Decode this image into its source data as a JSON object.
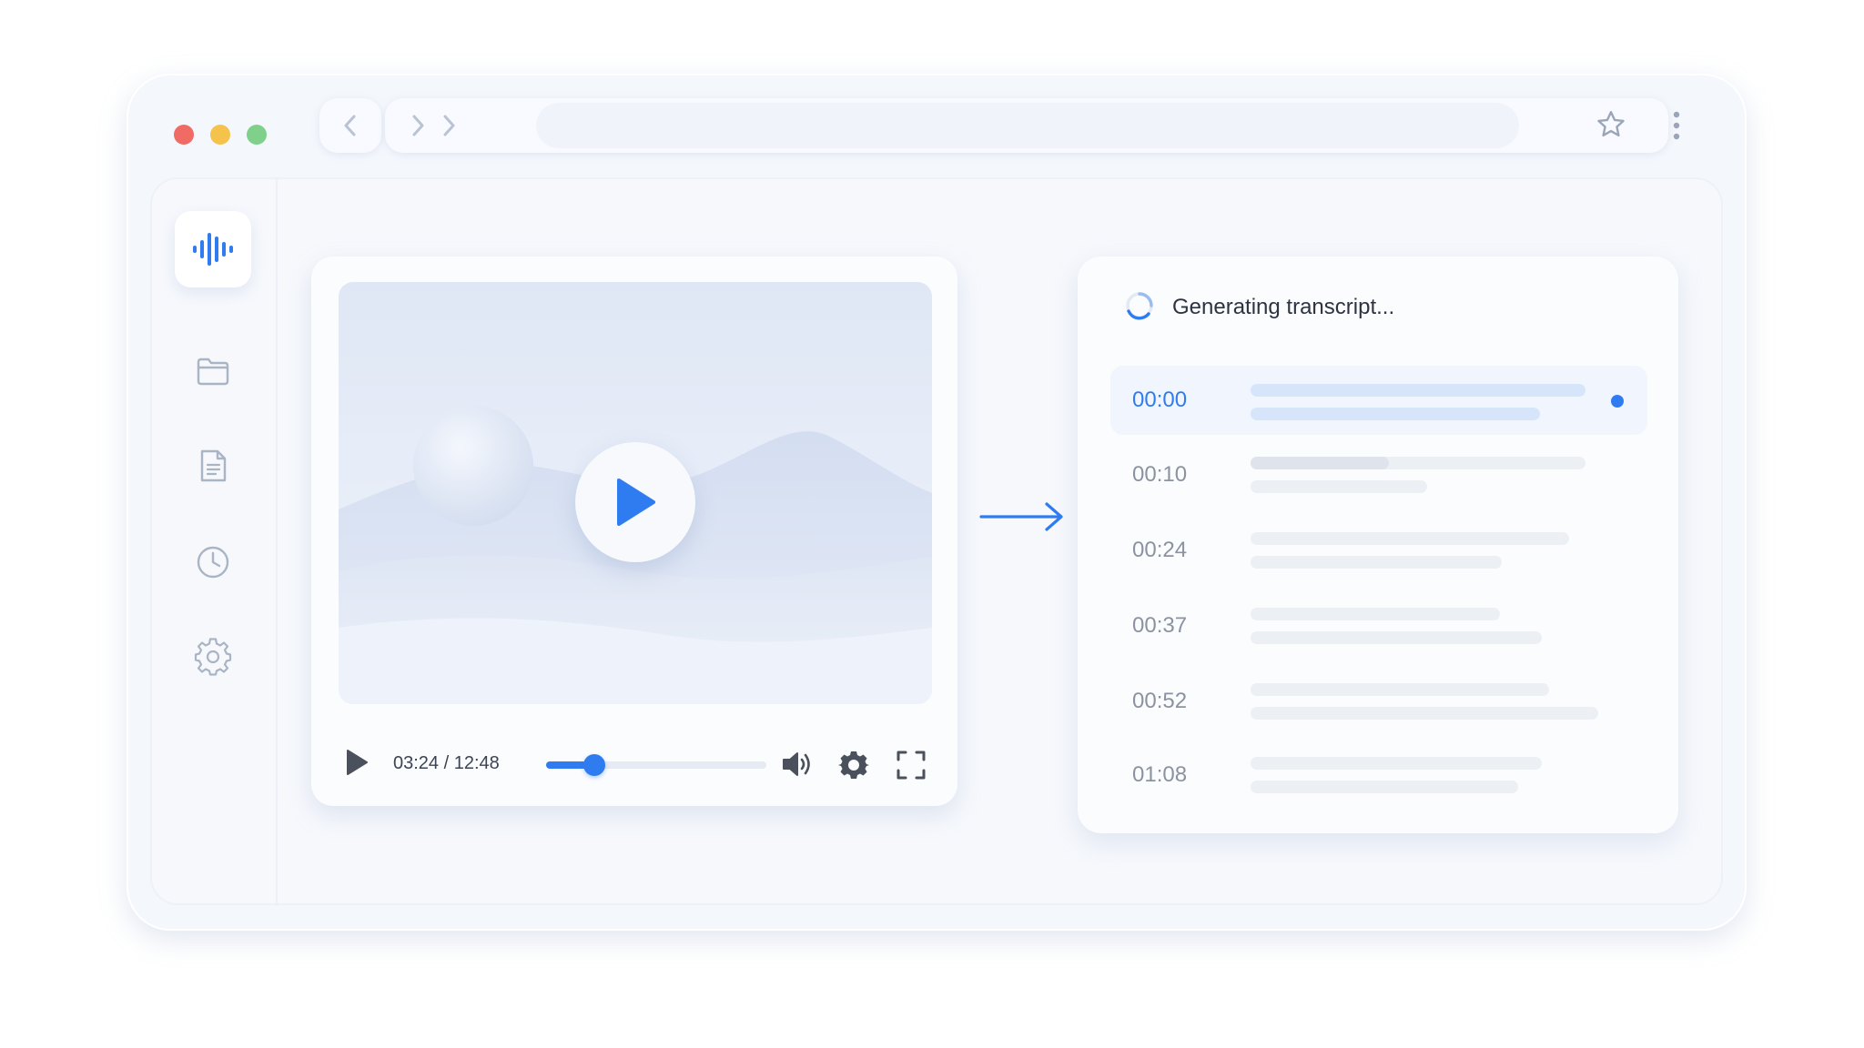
{
  "player": {
    "time_display": "03:24 / 12:48",
    "progress": 0.22
  },
  "transcript": {
    "status_text": "Generating transcript...",
    "rows": [
      {
        "time": "00:00",
        "active": true
      },
      {
        "time": "00:10",
        "active": false
      },
      {
        "time": "00:24",
        "active": false
      },
      {
        "time": "00:37",
        "active": false
      },
      {
        "time": "00:52",
        "active": false
      },
      {
        "time": "01:08",
        "active": false
      }
    ]
  },
  "icons": {
    "sidebar": [
      "waveform-icon",
      "folder-icon",
      "document-icon",
      "clock-icon",
      "gear-icon"
    ],
    "browser": [
      "back-icon",
      "forward-icon",
      "star-icon",
      "kebab-menu-icon"
    ],
    "player": [
      "play-icon",
      "volume-icon",
      "settings-icon",
      "fullscreen-icon"
    ]
  },
  "colors": {
    "accent": "#2f7cf0",
    "close_dot": "#f06b64",
    "minimize_dot": "#f5c24c",
    "maximize_dot": "#7fd08a"
  }
}
